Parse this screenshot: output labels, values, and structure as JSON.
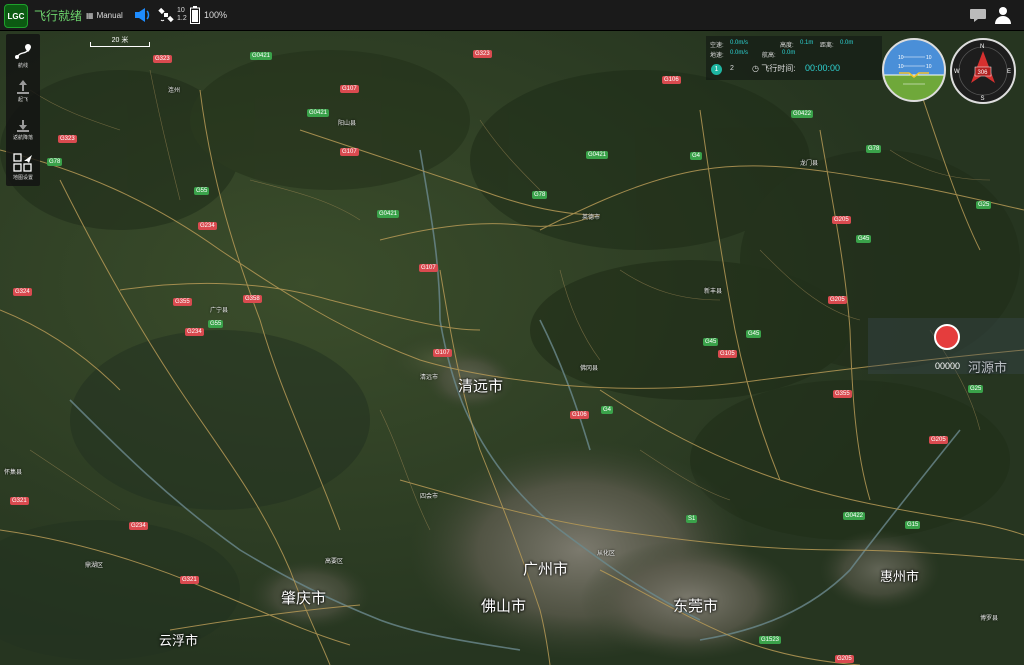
{
  "app": {
    "logo": "LGC",
    "status": "飞行就绪",
    "mode": "Manual",
    "satellites": "10",
    "hdop": "1.2",
    "battery": "100%"
  },
  "colors": {
    "ready": "#6cd36c",
    "accent": "#2ed3d3",
    "marker": "#e53d3d",
    "road_national": "#d94a4f",
    "road_expressway": "#3aa24a"
  },
  "tools": [
    {
      "label": "航线",
      "icon": "route-plan-icon"
    },
    {
      "label": "起飞",
      "icon": "takeoff-icon"
    },
    {
      "label": "返航降落",
      "icon": "return-land-icon"
    },
    {
      "label": "地图设置",
      "icon": "map-settings-icon"
    }
  ],
  "scale": {
    "label": "20 米"
  },
  "telemetry": {
    "row1": [
      {
        "label": "空速:",
        "value": "0.0m/s"
      },
      {
        "label": "高度:",
        "value": "0.1m"
      },
      {
        "label": "距离:",
        "value": "0.0m"
      }
    ],
    "row2": [
      {
        "label": "地速:",
        "value": "0.0m/s"
      },
      {
        "label": "航高:",
        "value": "0.0m"
      }
    ],
    "flag_number": "1",
    "waypoint_count": "2",
    "flight_time_label": "飞行时间:",
    "flight_time": "00:00:00"
  },
  "attitude": {
    "ticks": [
      "10",
      "10",
      "10",
      "10"
    ]
  },
  "compass": {
    "n": "N",
    "s": "S",
    "e": "E",
    "w": "W",
    "heading": "306"
  },
  "marker": {
    "label": "00000"
  },
  "cities": [
    {
      "name": "清远市"
    },
    {
      "name": "广州市"
    },
    {
      "name": "佛山市"
    },
    {
      "name": "东莞市"
    },
    {
      "name": "肇庆市"
    },
    {
      "name": "惠州市"
    },
    {
      "name": "河源市"
    },
    {
      "name": "云浮市"
    }
  ],
  "towns": [
    "清远市",
    "英德市",
    "佛冈县",
    "阳山县",
    "新丰县",
    "连州",
    "怀集县",
    "广宁县",
    "四会市",
    "从化区",
    "龙门县",
    "博罗县",
    "高要区",
    "鼎湖区"
  ],
  "roads_national": [
    "G323",
    "G323",
    "G323",
    "G107",
    "G107",
    "G107",
    "G107",
    "G355",
    "G358",
    "G234",
    "G234",
    "G106",
    "G106",
    "G105",
    "G205",
    "G205",
    "G205",
    "G355",
    "G324",
    "G321",
    "G234",
    "G321",
    "G205"
  ],
  "roads_expressway": [
    "G0421",
    "G0421",
    "G0421",
    "G0421",
    "G55",
    "G55",
    "G78",
    "G78",
    "G78",
    "G4",
    "G4",
    "G45",
    "G45",
    "G45",
    "G25",
    "G25",
    "G15",
    "G1523",
    "G0422",
    "G0422",
    "S1"
  ]
}
